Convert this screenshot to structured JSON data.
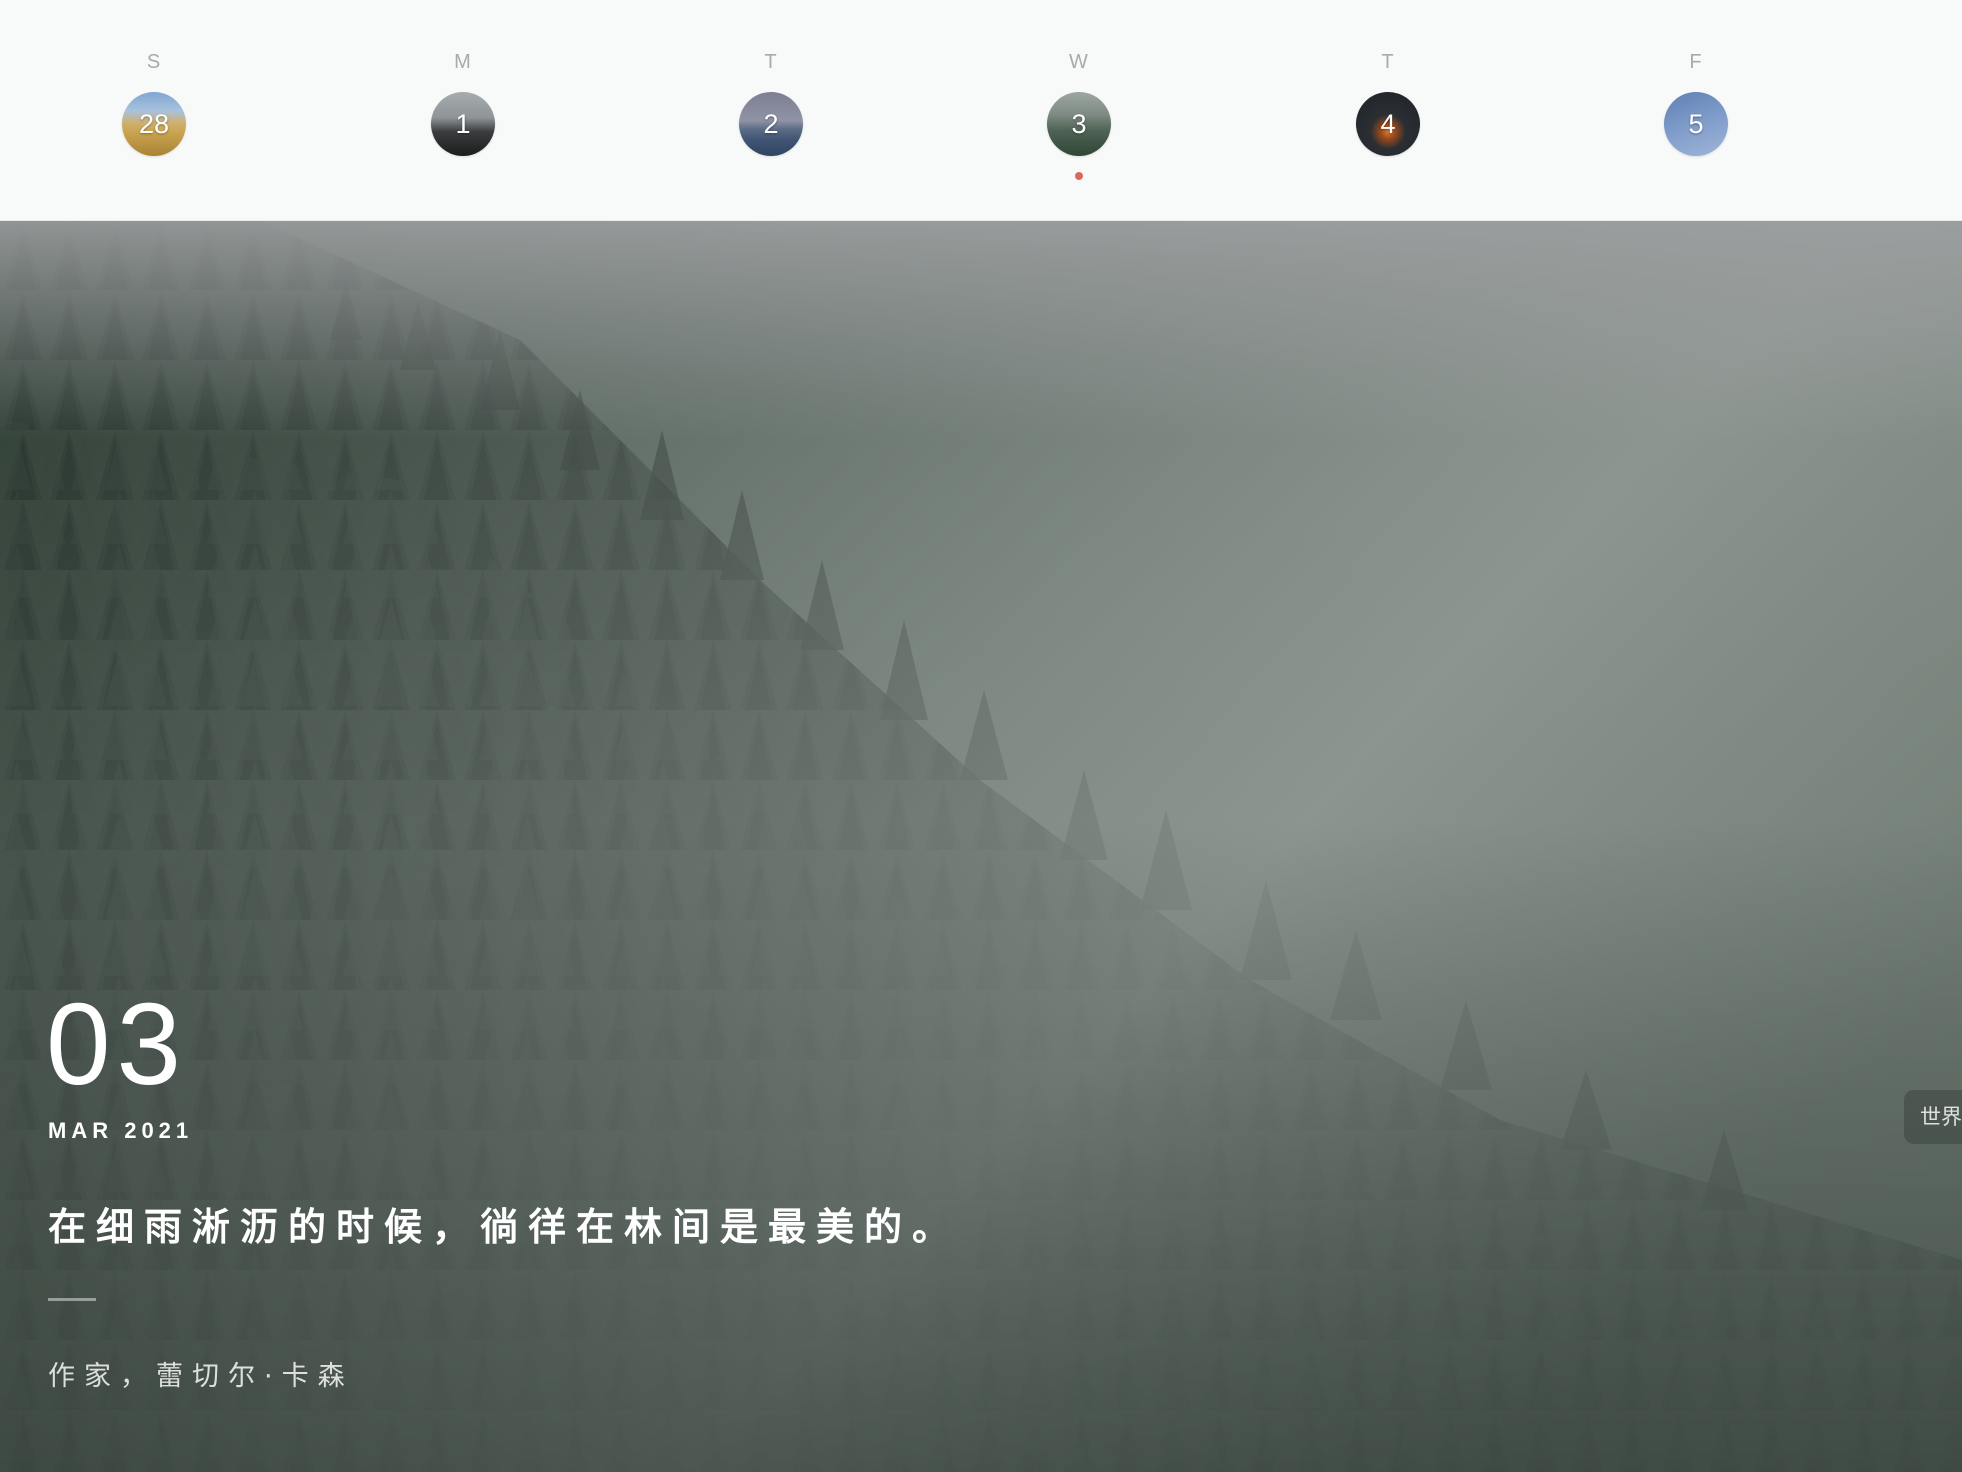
{
  "week": {
    "days": [
      {
        "letter": "S",
        "number": "28",
        "thumb": "golden-field"
      },
      {
        "letter": "M",
        "number": "1",
        "thumb": "dark-silhouette"
      },
      {
        "letter": "T",
        "number": "2",
        "thumb": "ocean-horizon"
      },
      {
        "letter": "W",
        "number": "3",
        "thumb": "misty-forest",
        "selected": true
      },
      {
        "letter": "T",
        "number": "4",
        "thumb": "campfire-night"
      },
      {
        "letter": "F",
        "number": "5",
        "thumb": "blue-sky-branch"
      }
    ],
    "today_dot_color": "#d9695c"
  },
  "hero": {
    "image": "misty-pine-forest",
    "day": "03",
    "month_year": "MAR 2021",
    "quote": "在细雨淅沥的时候，徜徉在林间是最美的。",
    "author": "作家，蕾切尔·卡森"
  },
  "side_tab": {
    "label": "世界"
  },
  "colors": {
    "strip_background": "#f8f9f9",
    "forest_dark": "#2f3e34",
    "mist": "#9aa39f"
  }
}
